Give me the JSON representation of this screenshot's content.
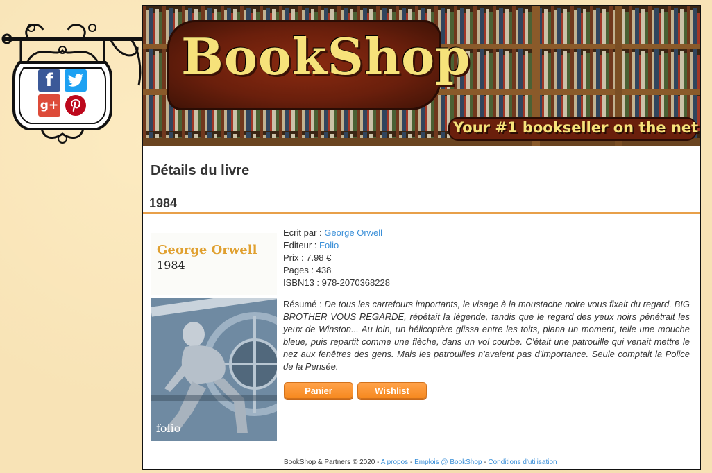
{
  "brand": {
    "logo_text": "BookShop",
    "tagline": "Your #1 bookseller on the net"
  },
  "social": [
    {
      "name": "facebook",
      "glyph": "f",
      "color": "#3b5998"
    },
    {
      "name": "twitter",
      "glyph": "",
      "color": "#1da1f2"
    },
    {
      "name": "google-plus",
      "glyph": "g+",
      "color": "#dd4b39"
    },
    {
      "name": "pinterest",
      "glyph": "",
      "color": "#bd081c"
    }
  ],
  "page": {
    "title": "Détails du livre"
  },
  "book": {
    "title": "1984",
    "cover": {
      "author": "George Orwell",
      "title": "1984",
      "publisher_mark": "folio"
    },
    "author_label": "Ecrit par : ",
    "author": "George Orwell",
    "publisher_label": "Editeur : ",
    "publisher": "Folio",
    "price_label": "Prix : ",
    "price": "7.98 €",
    "pages_label": "Pages : ",
    "pages": "438",
    "isbn_label": "ISBN13 : ",
    "isbn": "978-2070368228",
    "summary_label": "Résumé : ",
    "summary": "De tous les carrefours importants, le visage à la moustache noire vous fixait du regard. BIG BROTHER VOUS REGARDE, répétait la légende, tandis que le regard des yeux noirs pénétrait les yeux de Winston... Au loin, un hélicoptère glissa entre les toits, plana un moment, telle une mouche bleue, puis repartit comme une flèche, dans un vol courbe. C'était une patrouille qui venait mettre le nez aux fenêtres des gens. Mais les patrouilles n'avaient pas d'importance. Seule comptait la Police de la Pensée."
  },
  "actions": {
    "cart_label": "Panier",
    "wishlist_label": "Wishlist"
  },
  "footer": {
    "copyright": "BookShop & Partners © 2020 - ",
    "about": "A propos",
    "sep1": " - ",
    "jobs": "Emplois @ BookShop",
    "sep2": " - ",
    "terms": "Conditions d'utilisation"
  },
  "colors": {
    "accent": "#f6891f",
    "link": "#3a8fd8",
    "divider": "#e8a04a"
  }
}
